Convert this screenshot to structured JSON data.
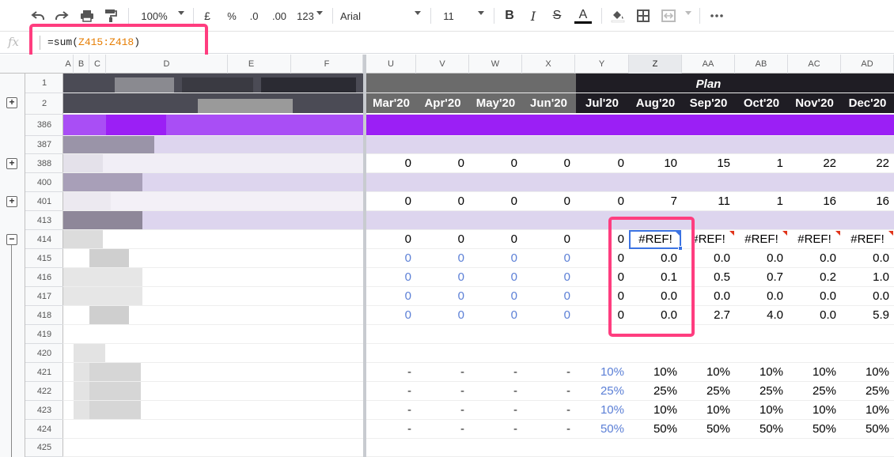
{
  "toolbar": {
    "zoom": "100%",
    "currency": "£",
    "percent": "%",
    "dec_decrease": ".0",
    "dec_increase": ".00",
    "more_formats": "123",
    "font_family": "Arial",
    "font_size": "11",
    "bold": "B",
    "italic": "I",
    "strike": "S",
    "text_color": "A"
  },
  "formula_bar": {
    "fx": "fx",
    "formula_prefix": "=sum(",
    "formula_ref": "Z415:Z418",
    "formula_suffix": ")"
  },
  "columns": [
    "A",
    "B",
    "C",
    "D",
    "E",
    "F",
    "U",
    "V",
    "W",
    "X",
    "Y",
    "Z",
    "AA",
    "AB",
    "AC",
    "AD"
  ],
  "selected_column": "Z",
  "header": {
    "plan_label": "Plan",
    "months": [
      "Mar'20",
      "Apr'20",
      "May'20",
      "Jun'20",
      "Jul'20",
      "Aug'20",
      "Sep'20",
      "Oct'20",
      "Nov'20",
      "Dec'20"
    ]
  },
  "row_numbers": [
    "1",
    "2",
    "386",
    "387",
    "388",
    "400",
    "401",
    "413",
    "414",
    "415",
    "416",
    "417",
    "418",
    "419",
    "420",
    "421",
    "422",
    "423",
    "424",
    "425"
  ],
  "rows": {
    "r388": [
      "0",
      "0",
      "0",
      "0",
      "0",
      "10",
      "15",
      "1",
      "22",
      "22"
    ],
    "r401": [
      "0",
      "0",
      "0",
      "0",
      "0",
      "7",
      "11",
      "1",
      "16",
      "16"
    ],
    "r414": [
      "0",
      "0",
      "0",
      "0",
      "0",
      "#REF!",
      "#REF!",
      "#REF!",
      "#REF!",
      "#REF!"
    ],
    "r415": [
      "0",
      "0",
      "0",
      "0",
      "0",
      "0.0",
      "0.0",
      "0.0",
      "0.0",
      "0.0"
    ],
    "r416": [
      "0",
      "0",
      "0",
      "0",
      "0",
      "0.1",
      "0.5",
      "0.7",
      "0.2",
      "1.0"
    ],
    "r417": [
      "0",
      "0",
      "0",
      "0",
      "0",
      "0.0",
      "0.0",
      "0.0",
      "0.0",
      "0.0"
    ],
    "r418": [
      "0",
      "0",
      "0",
      "0",
      "0",
      "0.0",
      "2.7",
      "4.0",
      "0.0",
      "5.9"
    ],
    "r421": [
      "-",
      "-",
      "-",
      "-",
      "10%",
      "10%",
      "10%",
      "10%",
      "10%",
      "10%"
    ],
    "r422": [
      "-",
      "-",
      "-",
      "-",
      "25%",
      "25%",
      "25%",
      "25%",
      "25%",
      "25%"
    ],
    "r423": [
      "-",
      "-",
      "-",
      "-",
      "10%",
      "10%",
      "10%",
      "10%",
      "10%",
      "10%"
    ],
    "r424": [
      "-",
      "-",
      "-",
      "-",
      "50%",
      "50%",
      "50%",
      "50%",
      "50%",
      "50%"
    ]
  },
  "colors": {
    "purple_band": "#9b1ff5",
    "lavender_band": "#ddd5ee",
    "header_gray": "#6b6b6b",
    "header_dark": "#1f1d24",
    "highlight": "#ff3d7f",
    "selection": "#3b73e3",
    "input_blue": "#5b7fd6",
    "error_marker": "#e0341a"
  },
  "icons": [
    "undo-icon",
    "redo-icon",
    "print-icon",
    "paint-format-icon",
    "fill-color-icon",
    "borders-icon",
    "merge-icon",
    "more-icon",
    "expand-group-icon",
    "collapse-group-icon"
  ]
}
